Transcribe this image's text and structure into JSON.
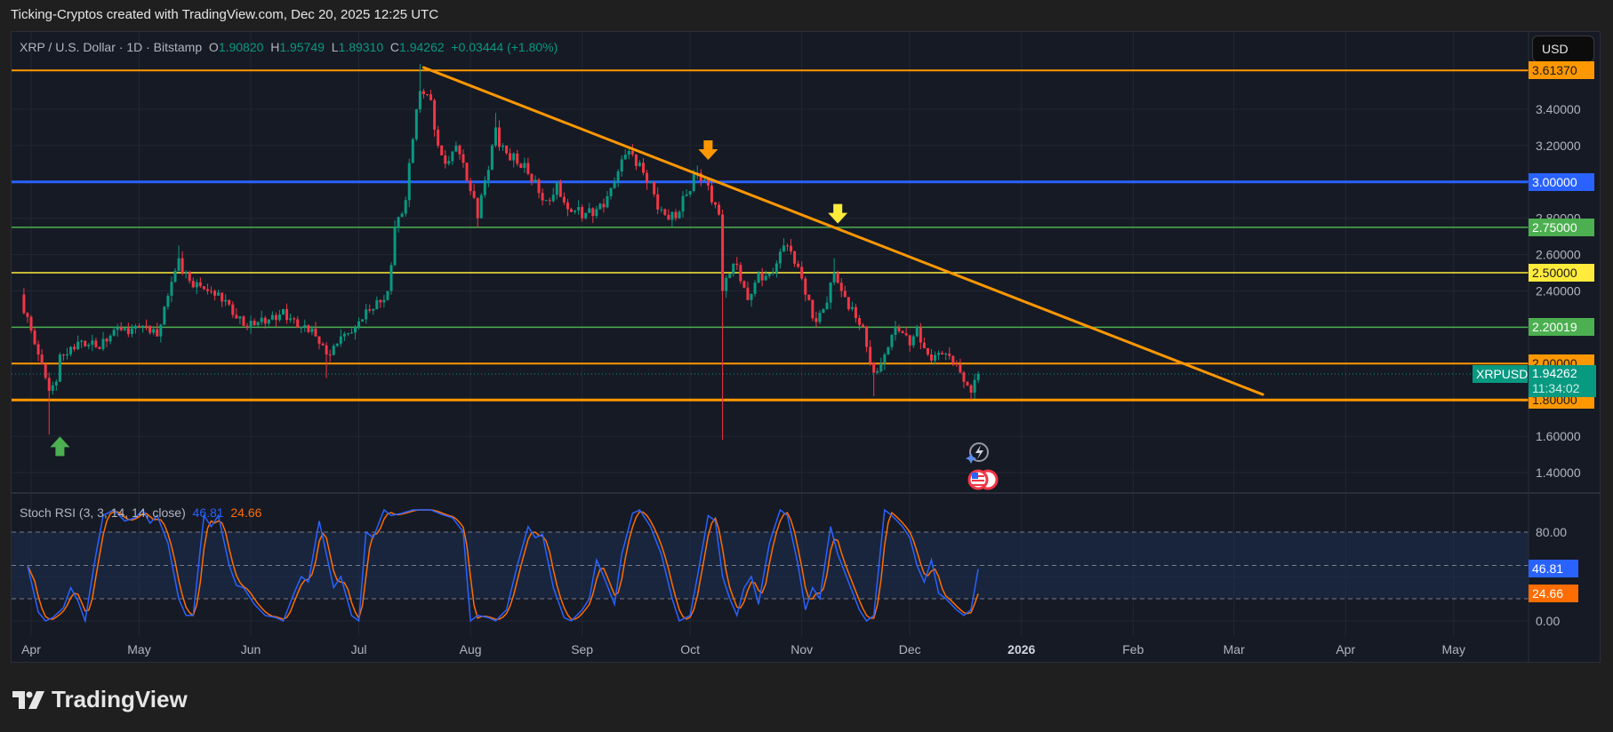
{
  "header": {
    "text": "Ticking-Cryptos created with TradingView.com, Dec 20, 2025 12:25 UTC"
  },
  "legend": {
    "symbol": "XRP / U.S. Dollar · 1D · Bitstamp",
    "o_label": "O",
    "o": "1.90820",
    "h_label": "H",
    "h": "1.95749",
    "l_label": "L",
    "l": "1.89310",
    "c_label": "C",
    "c": "1.94262",
    "change": "+0.03444 (+1.80%)"
  },
  "currency_button": "USD",
  "price_axis": {
    "ticks": [
      "3.40000",
      "3.20000",
      "2.80000",
      "2.60000",
      "2.40000",
      "1.60000",
      "1.40000"
    ],
    "tick_values": [
      3.4,
      3.2,
      2.8,
      2.6,
      2.4,
      1.6,
      1.4
    ]
  },
  "levels": [
    {
      "value": 3.6137,
      "label": "3.61370",
      "color": "#ff9800",
      "text_color": "#1a1a1a"
    },
    {
      "value": 3.0,
      "label": "3.00000",
      "color": "#2962ff",
      "text_color": "#ffffff"
    },
    {
      "value": 2.75,
      "label": "2.75000",
      "color": "#4caf50",
      "text_color": "#ffffff"
    },
    {
      "value": 2.5,
      "label": "2.50000",
      "color": "#ffeb3b",
      "text_color": "#1a1a1a"
    },
    {
      "value": 2.20019,
      "label": "2.20019",
      "color": "#4caf50",
      "text_color": "#ffffff"
    },
    {
      "value": 2.0,
      "label": "2.00000",
      "color": "#ff9800",
      "text_color": "#1a1a1a"
    },
    {
      "value": 1.8,
      "label": "1.80000",
      "color": "#ff9800",
      "text_color": "#1a1a1a"
    }
  ],
  "last_price": {
    "symbol": "XRPUSD",
    "price": "1.94262",
    "value": 1.94262,
    "countdown": "11:34:02",
    "color": "#089981"
  },
  "trendline": {
    "from": {
      "date": "2025-07-19",
      "price": 3.63
    },
    "to": {
      "date": "2026-03-09",
      "price": 1.83
    },
    "color": "#ff9800"
  },
  "markers": [
    {
      "type": "arrow-down",
      "date": "2025-10-06",
      "price": 3.17,
      "color": "#ff9800"
    },
    {
      "type": "arrow-down",
      "date": "2025-11-11",
      "price": 2.82,
      "color": "#ffeb3b"
    },
    {
      "type": "arrow-up",
      "date": "2025-04-09",
      "price": 1.55,
      "color": "#4caf50"
    }
  ],
  "events": [
    {
      "icon": "lightning-icon"
    },
    {
      "icon": "us-flag-icon"
    }
  ],
  "time_axis": {
    "labels": [
      {
        "text": "Apr",
        "date": "2025-04-01"
      },
      {
        "text": "May",
        "date": "2025-05-01"
      },
      {
        "text": "Jun",
        "date": "2025-06-01"
      },
      {
        "text": "Jul",
        "date": "2025-07-01"
      },
      {
        "text": "Aug",
        "date": "2025-08-01"
      },
      {
        "text": "Sep",
        "date": "2025-09-01"
      },
      {
        "text": "Oct",
        "date": "2025-10-01"
      },
      {
        "text": "Nov",
        "date": "2025-11-01"
      },
      {
        "text": "Dec",
        "date": "2025-12-01"
      },
      {
        "text": "2026",
        "date": "2026-01-01",
        "bold": true
      },
      {
        "text": "Feb",
        "date": "2026-02-01"
      },
      {
        "text": "Mar",
        "date": "2026-03-01"
      },
      {
        "text": "Apr",
        "date": "2026-04-01"
      },
      {
        "text": "May",
        "date": "2026-05-01"
      }
    ]
  },
  "stoch": {
    "title": "Stoch RSI (3, 3, 14, 14, close)",
    "k_value": "46.81",
    "d_value": "24.66",
    "k_color": "#2962ff",
    "d_color": "#ff6d00",
    "axis_ticks": [
      "80.00",
      "0.00"
    ],
    "band": [
      20,
      80
    ]
  },
  "chart_data": {
    "type": "candlestick",
    "scale": "linear",
    "ylim": [
      1.3,
      3.75
    ],
    "close_anchors": [
      [
        "2025-03-29",
        2.38
      ],
      [
        "2025-04-03",
        2.05
      ],
      [
        "2025-04-06",
        1.85,
        1.61
      ],
      [
        "2025-04-08",
        1.9
      ],
      [
        "2025-04-09",
        2.05
      ],
      [
        "2025-04-14",
        2.12
      ],
      [
        "2025-04-20",
        2.08
      ],
      [
        "2025-04-25",
        2.2
      ],
      [
        "2025-05-01",
        2.2
      ],
      [
        "2025-05-06",
        2.15
      ],
      [
        "2025-05-10",
        2.45
      ],
      [
        "2025-05-12",
        2.58,
        null,
        2.65
      ],
      [
        "2025-05-16",
        2.42
      ],
      [
        "2025-05-20",
        2.4
      ],
      [
        "2025-05-25",
        2.35
      ],
      [
        "2025-05-31",
        2.2
      ],
      [
        "2025-06-05",
        2.22
      ],
      [
        "2025-06-10",
        2.3
      ],
      [
        "2025-06-15",
        2.2
      ],
      [
        "2025-06-19",
        2.15
      ],
      [
        "2025-06-22",
        2.05,
        1.92
      ],
      [
        "2025-06-26",
        2.15
      ],
      [
        "2025-06-30",
        2.2
      ],
      [
        "2025-07-05",
        2.3
      ],
      [
        "2025-07-09",
        2.4
      ],
      [
        "2025-07-11",
        2.75
      ],
      [
        "2025-07-14",
        2.9
      ],
      [
        "2025-07-17",
        3.4
      ],
      [
        "2025-07-18",
        3.5,
        null,
        3.65
      ],
      [
        "2025-07-21",
        3.45
      ],
      [
        "2025-07-23",
        3.2
      ],
      [
        "2025-07-25",
        3.1
      ],
      [
        "2025-07-28",
        3.2
      ],
      [
        "2025-08-01",
        2.95
      ],
      [
        "2025-08-03",
        2.8,
        2.75
      ],
      [
        "2025-08-08",
        3.3,
        null,
        3.38
      ],
      [
        "2025-08-10",
        3.2
      ],
      [
        "2025-08-14",
        3.1
      ],
      [
        "2025-08-18",
        3.0
      ],
      [
        "2025-08-22",
        2.9
      ],
      [
        "2025-08-25",
        3.0
      ],
      [
        "2025-08-28",
        2.85
      ],
      [
        "2025-09-01",
        2.8
      ],
      [
        "2025-09-05",
        2.85
      ],
      [
        "2025-09-10",
        3.0
      ],
      [
        "2025-09-13",
        3.15,
        null,
        3.18
      ],
      [
        "2025-09-18",
        3.05
      ],
      [
        "2025-09-20",
        3.0
      ],
      [
        "2025-09-23",
        2.85
      ],
      [
        "2025-09-27",
        2.8
      ],
      [
        "2025-10-01",
        2.95
      ],
      [
        "2025-10-03",
        3.05,
        null,
        3.09
      ],
      [
        "2025-10-06",
        2.98
      ],
      [
        "2025-10-09",
        2.82
      ],
      [
        "2025-10-10",
        2.4,
        1.58
      ],
      [
        "2025-10-13",
        2.55
      ],
      [
        "2025-10-17",
        2.35
      ],
      [
        "2025-10-20",
        2.5
      ],
      [
        "2025-10-24",
        2.5
      ],
      [
        "2025-10-27",
        2.65,
        null,
        2.69
      ],
      [
        "2025-10-30",
        2.55
      ],
      [
        "2025-11-03",
        2.35
      ],
      [
        "2025-11-04",
        2.25
      ],
      [
        "2025-11-07",
        2.3
      ],
      [
        "2025-11-10",
        2.5,
        null,
        2.58
      ],
      [
        "2025-11-12",
        2.4
      ],
      [
        "2025-11-14",
        2.3
      ],
      [
        "2025-11-18",
        2.2
      ],
      [
        "2025-11-21",
        1.95,
        1.82
      ],
      [
        "2025-11-24",
        2.05
      ],
      [
        "2025-11-27",
        2.2
      ],
      [
        "2025-12-01",
        2.1
      ],
      [
        "2025-12-03",
        2.2
      ],
      [
        "2025-12-06",
        2.05
      ],
      [
        "2025-12-10",
        2.05
      ],
      [
        "2025-12-13",
        2.0
      ],
      [
        "2025-12-16",
        1.9
      ],
      [
        "2025-12-18",
        1.84,
        1.8
      ],
      [
        "2025-12-19",
        1.91
      ],
      [
        "2025-12-20",
        1.94262,
        1.8931,
        1.95749
      ]
    ],
    "stoch_k_anchors": [
      [
        "2025-03-31",
        50
      ],
      [
        "2025-04-03",
        8
      ],
      [
        "2025-04-05",
        0
      ],
      [
        "2025-04-07",
        3
      ],
      [
        "2025-04-10",
        12
      ],
      [
        "2025-04-12",
        30
      ],
      [
        "2025-04-14",
        18
      ],
      [
        "2025-04-16",
        0
      ],
      [
        "2025-04-19",
        60
      ],
      [
        "2025-04-21",
        95
      ],
      [
        "2025-04-24",
        100
      ],
      [
        "2025-04-27",
        90
      ],
      [
        "2025-04-30",
        93
      ],
      [
        "2025-05-02",
        100
      ],
      [
        "2025-05-04",
        88
      ],
      [
        "2025-05-06",
        95
      ],
      [
        "2025-05-09",
        70
      ],
      [
        "2025-05-12",
        20
      ],
      [
        "2025-05-14",
        5
      ],
      [
        "2025-05-16",
        5
      ],
      [
        "2025-05-19",
        95
      ],
      [
        "2025-05-21",
        85
      ],
      [
        "2025-05-23",
        95
      ],
      [
        "2025-05-26",
        50
      ],
      [
        "2025-05-28",
        32
      ],
      [
        "2025-05-30",
        30
      ],
      [
        "2025-06-02",
        15
      ],
      [
        "2025-06-05",
        5
      ],
      [
        "2025-06-08",
        3
      ],
      [
        "2025-06-10",
        0
      ],
      [
        "2025-06-13",
        25
      ],
      [
        "2025-06-15",
        40
      ],
      [
        "2025-06-17",
        35
      ],
      [
        "2025-06-20",
        90
      ],
      [
        "2025-06-22",
        60
      ],
      [
        "2025-06-24",
        30
      ],
      [
        "2025-06-26",
        40
      ],
      [
        "2025-06-29",
        5
      ],
      [
        "2025-07-01",
        0
      ],
      [
        "2025-07-03",
        80
      ],
      [
        "2025-07-05",
        75
      ],
      [
        "2025-07-08",
        100
      ],
      [
        "2025-07-10",
        95
      ],
      [
        "2025-07-13",
        97
      ],
      [
        "2025-07-16",
        100
      ],
      [
        "2025-07-21",
        100
      ],
      [
        "2025-07-24",
        96
      ],
      [
        "2025-07-27",
        93
      ],
      [
        "2025-07-30",
        80
      ],
      [
        "2025-08-01",
        0
      ],
      [
        "2025-08-03",
        5
      ],
      [
        "2025-08-06",
        3
      ],
      [
        "2025-08-08",
        0
      ],
      [
        "2025-08-11",
        10
      ],
      [
        "2025-08-14",
        50
      ],
      [
        "2025-08-17",
        85
      ],
      [
        "2025-08-19",
        75
      ],
      [
        "2025-08-21",
        78
      ],
      [
        "2025-08-24",
        30
      ],
      [
        "2025-08-27",
        3
      ],
      [
        "2025-08-29",
        0
      ],
      [
        "2025-09-01",
        10
      ],
      [
        "2025-09-03",
        20
      ],
      [
        "2025-09-05",
        55
      ],
      [
        "2025-09-07",
        40
      ],
      [
        "2025-09-10",
        15
      ],
      [
        "2025-09-12",
        60
      ],
      [
        "2025-09-15",
        97
      ],
      [
        "2025-09-17",
        100
      ],
      [
        "2025-09-20",
        85
      ],
      [
        "2025-09-23",
        60
      ],
      [
        "2025-09-26",
        20
      ],
      [
        "2025-09-28",
        0
      ],
      [
        "2025-10-01",
        5
      ],
      [
        "2025-10-03",
        40
      ],
      [
        "2025-10-06",
        95
      ],
      [
        "2025-10-08",
        90
      ],
      [
        "2025-10-10",
        40
      ],
      [
        "2025-10-12",
        20
      ],
      [
        "2025-10-14",
        5
      ],
      [
        "2025-10-16",
        30
      ],
      [
        "2025-10-18",
        40
      ],
      [
        "2025-10-20",
        15
      ],
      [
        "2025-10-23",
        70
      ],
      [
        "2025-10-26",
        100
      ],
      [
        "2025-10-28",
        95
      ],
      [
        "2025-10-31",
        50
      ],
      [
        "2025-11-02",
        10
      ],
      [
        "2025-11-04",
        30
      ],
      [
        "2025-11-06",
        20
      ],
      [
        "2025-11-09",
        85
      ],
      [
        "2025-11-11",
        60
      ],
      [
        "2025-11-14",
        35
      ],
      [
        "2025-11-17",
        10
      ],
      [
        "2025-11-19",
        0
      ],
      [
        "2025-11-21",
        5
      ],
      [
        "2025-11-24",
        100
      ],
      [
        "2025-11-26",
        95
      ],
      [
        "2025-11-29",
        85
      ],
      [
        "2025-12-01",
        75
      ],
      [
        "2025-12-03",
        50
      ],
      [
        "2025-12-05",
        35
      ],
      [
        "2025-12-07",
        55
      ],
      [
        "2025-12-09",
        25
      ],
      [
        "2025-12-11",
        20
      ],
      [
        "2025-12-14",
        10
      ],
      [
        "2025-12-16",
        5
      ],
      [
        "2025-12-18",
        10
      ],
      [
        "2025-12-20",
        46.81
      ]
    ],
    "stoch_d_last": 24.66,
    "colors": {
      "up": "#089981",
      "down": "#f23645"
    }
  }
}
